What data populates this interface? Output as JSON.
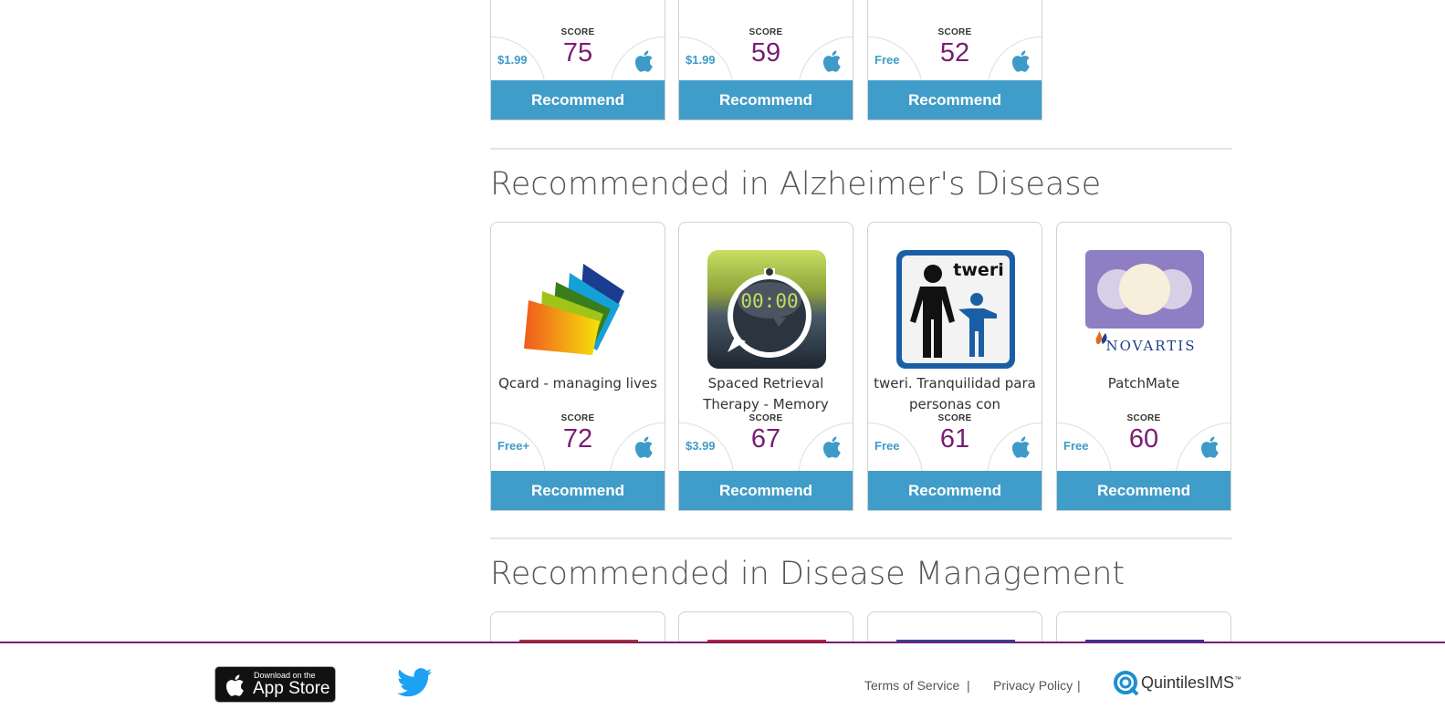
{
  "top_row": [
    {
      "price": "$1.99",
      "score_label": "SCORE",
      "score": "75",
      "button": "Recommend"
    },
    {
      "price": "$1.99",
      "score_label": "SCORE",
      "score": "59",
      "button": "Recommend"
    },
    {
      "price": "Free",
      "score_label": "SCORE",
      "score": "52",
      "button": "Recommend"
    }
  ],
  "sections": [
    {
      "title": "Recommended in Alzheimer's Disease",
      "apps": [
        {
          "name": "Qcard - managing lives",
          "price": "Free+",
          "score_label": "SCORE",
          "score": "72",
          "button": "Recommend",
          "icon": "qcard-icon"
        },
        {
          "name": "Spaced Retrieval Therapy - Memory",
          "price": "$3.99",
          "score_label": "SCORE",
          "score": "67",
          "button": "Recommend",
          "icon": "stopwatch-icon",
          "timer": "00:00"
        },
        {
          "name": "tweri. Tranquilidad para personas con",
          "price": "Free",
          "score_label": "SCORE",
          "score": "61",
          "button": "Recommend",
          "icon": "tweri-icon",
          "icon_text": "tweri"
        },
        {
          "name": "PatchMate",
          "price": "Free",
          "score_label": "SCORE",
          "score": "60",
          "button": "Recommend",
          "icon": "novartis-icon",
          "icon_text": "NOVARTIS"
        }
      ]
    },
    {
      "title": "Recommended in Disease Management",
      "apps": []
    }
  ],
  "footer": {
    "appstore_small": "Download on the",
    "appstore_big": "App Store",
    "terms": "Terms of Service",
    "privacy": "Privacy Policy",
    "separator": "|",
    "brand": "QuintilesIMS",
    "brand_tm": "™"
  },
  "colors": {
    "accent": "#409cc9",
    "score": "#7a1c6f",
    "footer_border": "#7a1c6f"
  }
}
